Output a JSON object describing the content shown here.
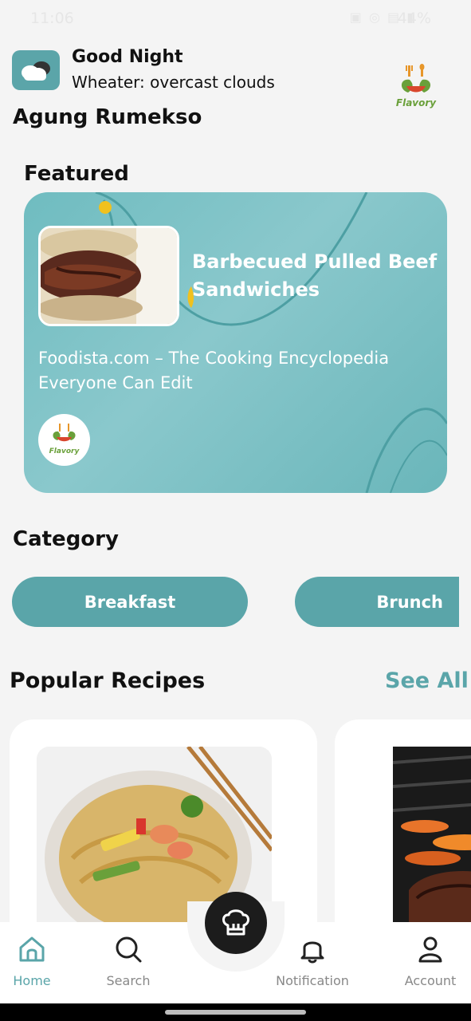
{
  "status_bar": {
    "time": "11:06",
    "battery": "44%"
  },
  "header": {
    "greeting": "Good Night",
    "weather": "Wheater: overcast clouds",
    "brand_name": "Flavory",
    "username": "Agung Rumekso"
  },
  "featured": {
    "section_title": "Featured",
    "recipe_name": "Barbecued Pulled Beef Sandwiches",
    "source": "Foodista.com – The Cooking Encyclopedia Everyone Can Edit",
    "logo_text": "Flavory"
  },
  "category": {
    "section_title": "Category",
    "items": [
      "Breakfast",
      "Brunch"
    ]
  },
  "popular": {
    "section_title": "Popular Recipes",
    "see_all": "See All"
  },
  "bottom_nav": {
    "items": [
      "Home",
      "Search",
      "Notification",
      "Account"
    ],
    "active": "Home"
  },
  "colors": {
    "accent": "#5aa5a9",
    "card_gradient_light": "#8ac8cc",
    "background": "#f4f4f4",
    "fab": "#1c1c1c"
  }
}
